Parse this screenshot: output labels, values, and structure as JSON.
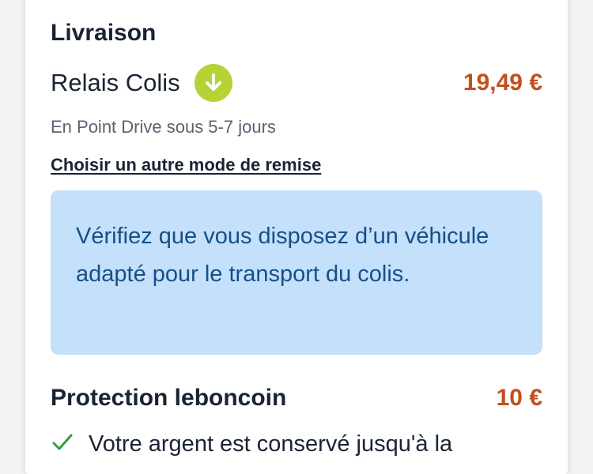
{
  "colors": {
    "accent": "#b5d334",
    "price": "#c2501d",
    "info_bg": "#c4e0fa",
    "info_text": "#174f88",
    "check": "#2f9e44"
  },
  "delivery": {
    "title": "Livraison",
    "carrier_name": "Relais Colis",
    "carrier_icon": "arrow-down-circle-icon",
    "price": "19,49 €",
    "delay": "En Point Drive sous 5-7 jours",
    "change_link": "Choisir un autre mode de remise",
    "info": "Vérifiez que vous disposez d’un véhicule adapté pour le transport du colis."
  },
  "protection": {
    "title": "Protection leboncoin",
    "price": "10 €",
    "check_icon": "check-icon",
    "first_item": "Votre argent est conservé jusqu'à la"
  }
}
